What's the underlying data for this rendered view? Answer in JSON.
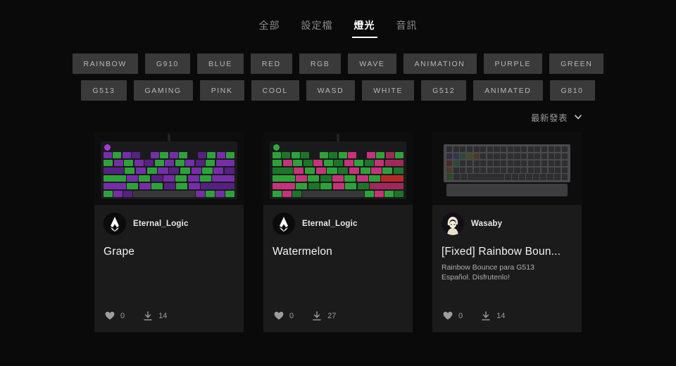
{
  "nav": {
    "tabs": [
      {
        "label": "全部",
        "active": false
      },
      {
        "label": "設定檔",
        "active": false
      },
      {
        "label": "燈光",
        "active": true
      },
      {
        "label": "音訊",
        "active": false
      }
    ]
  },
  "filters": {
    "rows": [
      [
        "RAINBOW",
        "G910",
        "BLUE",
        "RED",
        "RGB",
        "WAVE",
        "ANIMATION",
        "PURPLE",
        "GREEN"
      ],
      [
        "G513",
        "GAMING",
        "PINK",
        "COOL",
        "WASD",
        "WHITE",
        "G512",
        "ANIMATED",
        "G810"
      ]
    ]
  },
  "sort": {
    "label": "最新發表",
    "icon": "chevron-down-icon"
  },
  "colors": {
    "page_bg": "#0a0a0a",
    "card_bg": "#1b1b1b",
    "chip_bg": "#3a3a3a",
    "chip_text": "#b8b8b8",
    "accent_text": "#ffffff",
    "muted_text": "#9a9a9a",
    "key_purple": "#7a2fb0",
    "key_green": "#2faa3c",
    "key_pink": "#d1357f",
    "key_red": "#c02a2a",
    "logo_purple": "#a23cd6"
  },
  "cards": [
    {
      "title": "Grape",
      "description": "",
      "author": "Eternal_Logic",
      "avatar_icon": "assassins-creed-avatar",
      "likes": "0",
      "downloads": "14",
      "thumb_type": "tkl-keyboard",
      "thumb_palette": [
        "#7a2fb0",
        "#2faa3c",
        "#5a2288",
        "#1e7a2a"
      ]
    },
    {
      "title": "Watermelon",
      "description": "",
      "author": "Eternal_Logic",
      "avatar_icon": "assassins-creed-avatar",
      "likes": "0",
      "downloads": "27",
      "thumb_type": "tkl-keyboard",
      "thumb_palette": [
        "#2faa3c",
        "#d1357f",
        "#1e7a2a",
        "#a82a5f"
      ]
    },
    {
      "title": "[Fixed] Rainbow Boun...",
      "description": "Rainbow Bounce para G513\nEspañol. Disfrutenlo!",
      "author": "Wasaby",
      "avatar_icon": "anime-character-avatar",
      "likes": "0",
      "downloads": "14",
      "thumb_type": "fullsize-keyboard",
      "thumb_palette": [
        "#3a3a3c",
        "#4a4a4c"
      ]
    }
  ],
  "icons": {
    "heart": "heart-icon",
    "download": "download-icon"
  }
}
